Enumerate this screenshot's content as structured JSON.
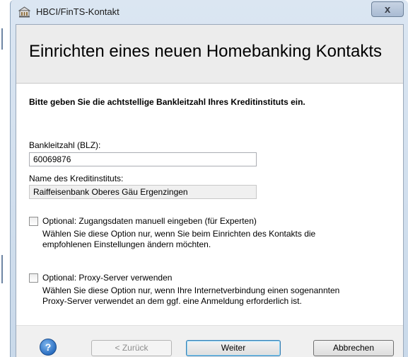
{
  "window": {
    "title": "HBCI/FinTS-Kontakt",
    "close_label": "x"
  },
  "header": {
    "heading": "Einrichten eines neuen Homebanking Kontakts"
  },
  "main": {
    "instruction": "Bitte geben Sie die achtstellige Bankleitzahl Ihres Kreditinstituts ein.",
    "blz": {
      "label": "Bankleitzahl (BLZ):",
      "value": "60069876"
    },
    "bank_name": {
      "label": "Name des Kreditinstituts:",
      "value": "Raiffeisenbank Oberes Gäu Ergenzingen"
    },
    "options": [
      {
        "label": "Optional: Zugangsdaten manuell eingeben (für Experten)",
        "checked": false,
        "description_lines": [
          "Wählen Sie diese Option nur, wenn Sie beim Einrichten des Kontakts die",
          "empfohlenen Einstellungen ändern möchten."
        ]
      },
      {
        "label": "Optional: Proxy-Server verwenden",
        "checked": false,
        "description_lines": [
          "Wählen Sie diese Option nur, wenn Ihre Internetverbindung einen sogenannten",
          "Proxy-Server verwendet an dem ggf. eine Anmeldung erforderlich ist."
        ]
      }
    ]
  },
  "footer": {
    "help_label": "?",
    "back_label": "< Zurück",
    "next_label": "Weiter",
    "cancel_label": "Abbrechen"
  },
  "icons": {
    "app": "bank-building-icon",
    "help": "help-icon",
    "close": "close-icon"
  },
  "colors": {
    "header_band": "#ececec",
    "titlebar": "#dbe6f2",
    "help_blue": "#2b6fc1",
    "default_button_border": "#3c7fb1"
  }
}
